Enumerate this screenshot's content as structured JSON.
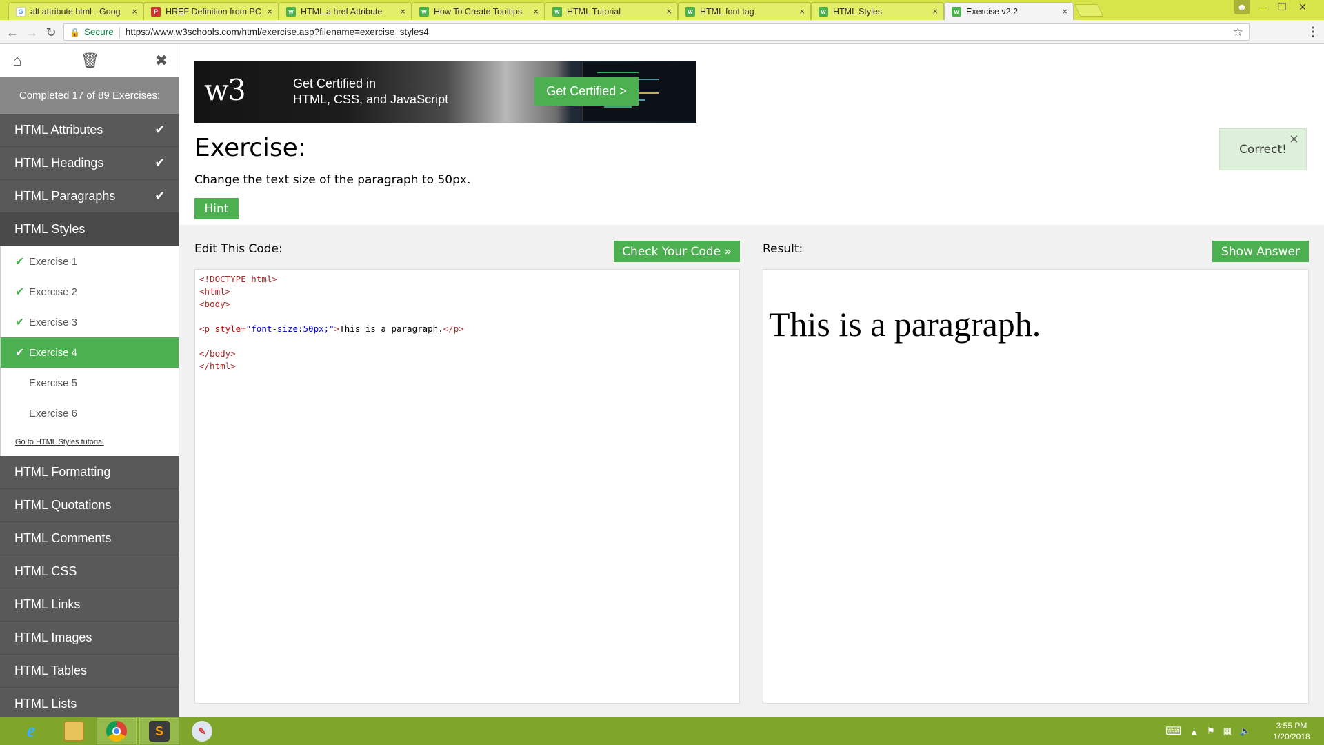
{
  "browser": {
    "tabs": [
      {
        "title": "alt attribute html - Goog",
        "favicon": "google-g"
      },
      {
        "title": "HREF Definition from PC",
        "favicon": "pc"
      },
      {
        "title": "HTML a href Attribute",
        "favicon": "w3"
      },
      {
        "title": "How To Create Tooltips",
        "favicon": "w3"
      },
      {
        "title": "HTML Tutorial",
        "favicon": "w3"
      },
      {
        "title": "HTML font tag",
        "favicon": "w3"
      },
      {
        "title": "HTML Styles",
        "favicon": "w3"
      },
      {
        "title": "Exercise v2.2",
        "favicon": "w3",
        "active": true
      }
    ],
    "tab_close": "×",
    "address": {
      "secure_label": "Secure",
      "url": "https://www.w3schools.com/html/exercise.asp?filename=exercise_styles4"
    }
  },
  "sidebar": {
    "progress": "Completed 17 of 89 Exercises:",
    "sections_before": [
      {
        "label": "HTML Attributes",
        "done": true
      },
      {
        "label": "HTML Headings",
        "done": true
      },
      {
        "label": "HTML Paragraphs",
        "done": true
      },
      {
        "label": "HTML Styles",
        "done": false
      }
    ],
    "sub_items": [
      {
        "label": "Exercise 1",
        "done": true
      },
      {
        "label": "Exercise 2",
        "done": true
      },
      {
        "label": "Exercise 3",
        "done": true
      },
      {
        "label": "Exercise 4",
        "done": true,
        "active": true
      },
      {
        "label": "Exercise 5",
        "done": false
      },
      {
        "label": "Exercise 6",
        "done": false
      }
    ],
    "tutorial_link": "Go to HTML Styles tutorial",
    "sections_after": [
      "HTML Formatting",
      "HTML Quotations",
      "HTML Comments",
      "HTML CSS",
      "HTML Links",
      "HTML Images",
      "HTML Tables",
      "HTML Lists"
    ]
  },
  "banner": {
    "logo": "w3",
    "line1": "Get Certified in",
    "line2": "HTML, CSS, and JavaScript",
    "button": "Get Certified >"
  },
  "exercise": {
    "title": "Exercise:",
    "description": "Change the text size of the paragraph to 50px.",
    "hint_label": "Hint",
    "toast": "Correct!",
    "toast_close": "×"
  },
  "editor": {
    "title": "Edit This Code:",
    "check_button": "Check Your Code »",
    "code_lines": [
      [
        {
          "t": "tag",
          "v": "<!DOCTYPE html>"
        }
      ],
      [
        {
          "t": "tag",
          "v": "<html>"
        }
      ],
      [
        {
          "t": "tag",
          "v": "<body>"
        }
      ],
      [],
      [
        {
          "t": "tag",
          "v": "<p "
        },
        {
          "t": "attr",
          "v": "style"
        },
        {
          "t": "tag",
          "v": "="
        },
        {
          "t": "val",
          "v": "\"font-size:50px;\""
        },
        {
          "t": "tag",
          "v": ">"
        },
        {
          "t": "txt",
          "v": "This is a paragraph."
        },
        {
          "t": "tag",
          "v": "</p>"
        }
      ],
      [],
      [
        {
          "t": "tag",
          "v": "</body>"
        }
      ],
      [
        {
          "t": "tag",
          "v": "</html>"
        }
      ]
    ]
  },
  "result": {
    "title": "Result:",
    "show_answer": "Show Answer",
    "paragraph": "This is a paragraph."
  },
  "taskbar": {
    "apps": [
      "internet-explorer",
      "file-explorer",
      "chrome",
      "sublime-text",
      "paint"
    ],
    "time": "3:55 PM",
    "date": "1/20/2018"
  },
  "colors": {
    "accent": "#4caf50",
    "sidebar": "#595959",
    "chrome_frame": "#d7e44a",
    "taskbar": "#7fa52b"
  }
}
